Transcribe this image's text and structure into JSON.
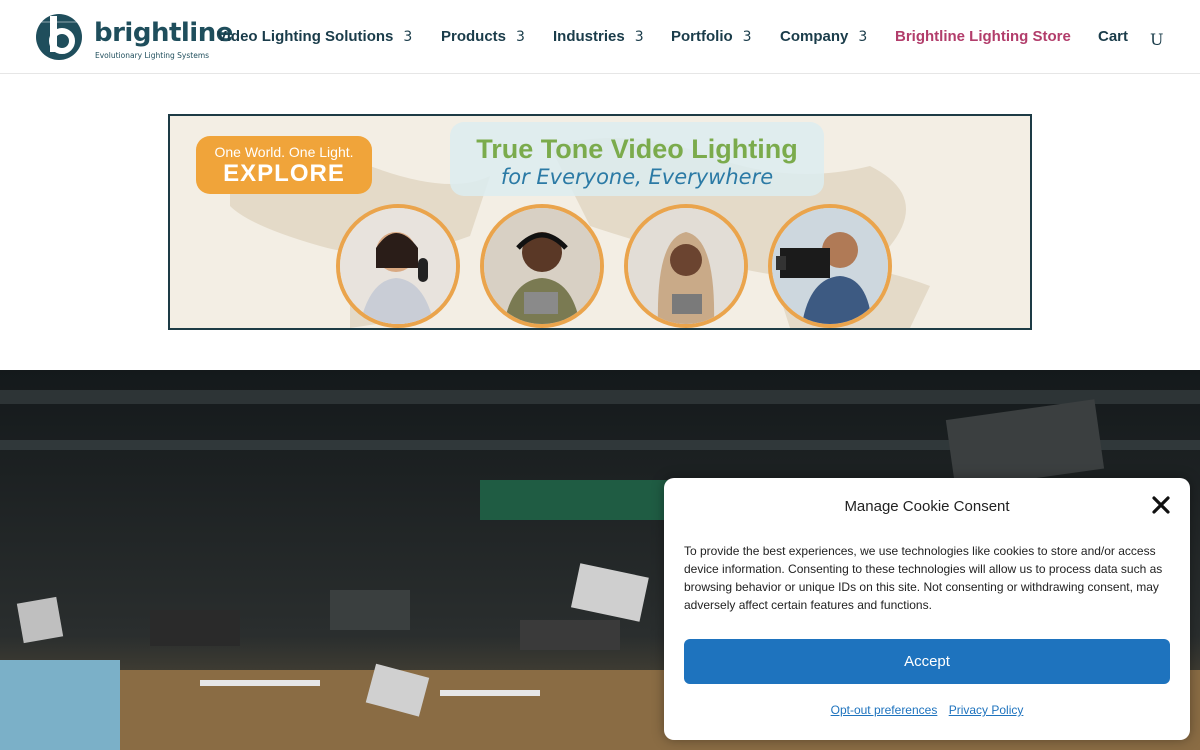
{
  "brand": {
    "name": "brightline",
    "tagline": "Evolutionary Lighting Systems",
    "accent": "#1f4e5c",
    "store_color": "#b23d6b"
  },
  "nav": {
    "items": [
      {
        "label": "Video Lighting Solutions",
        "chevron": "3"
      },
      {
        "label": "Products",
        "chevron": "3"
      },
      {
        "label": "Industries",
        "chevron": "3"
      },
      {
        "label": "Portfolio",
        "chevron": "3"
      },
      {
        "label": "Company",
        "chevron": "3"
      }
    ],
    "store": "Brightline Lighting Store",
    "cart": "Cart",
    "search_glyph": "U"
  },
  "banner": {
    "explore_top": "One World. One Light.",
    "explore_bottom": "EXPLORE",
    "headline": "True Tone Video Lighting",
    "subheadline": "for Everyone, Everywhere"
  },
  "cookie": {
    "title": "Manage Cookie Consent",
    "body": "To provide the best experiences, we use technologies like cookies to store and/or access device information. Consenting to these technologies will allow us to process data such as browsing behavior or unique IDs on this site. Not consenting or withdrawing consent, may adversely affect certain features and functions.",
    "accept": "Accept",
    "opt_out": "Opt-out preferences",
    "privacy": "Privacy Policy",
    "button_color": "#1e73be"
  }
}
